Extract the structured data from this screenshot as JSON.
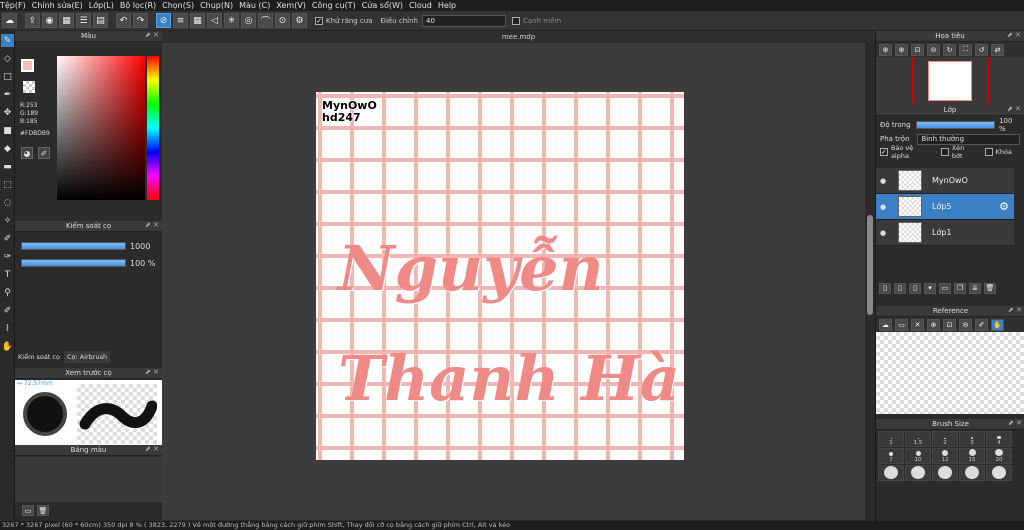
{
  "menu": [
    "Tệp(F)",
    "Chỉnh sửa(E)",
    "Lớp(L)",
    "Bộ lọc(R)",
    "Chọn(S)",
    "Chụp(N)",
    "Màu (C)",
    "Xem(V)",
    "Công cụ(T)",
    "Cửa sổ(W)",
    "Cloud",
    "Help"
  ],
  "toolbar": {
    "antialias_label": "Khử răng cưa",
    "adjust_label": "Điều chỉnh",
    "adjust_value": "40",
    "edge_label": "Cạnh mềm"
  },
  "color_panel": {
    "title": "Màu",
    "fg_color": "#FDBDB9",
    "r": "R:253",
    "g": "G:189",
    "b": "B:185",
    "hex": "#FDBDB9"
  },
  "brush_control": {
    "title": "Kiểm soát cọ",
    "size_value": "1000",
    "opacity_value": "100 %"
  },
  "small_tabs": [
    "Kiểm soát cọ",
    "Cọ: Airbrush"
  ],
  "preview": {
    "title": "Xem trước cọ",
    "size_label": "72.57mm"
  },
  "palette": {
    "title": "Bảng màu"
  },
  "document": {
    "filename": "mee.mdp",
    "signature_line1": "MynOwO",
    "signature_line2": "hd247",
    "text_line1": "Nguyễn",
    "text_line2": "Thanh Hà"
  },
  "navigator": {
    "title": "Hoa tiêu"
  },
  "layer_panel": {
    "title": "Lớp",
    "opacity_label": "Độ trong",
    "opacity_value": "100 %",
    "blend_label": "Pha trộn",
    "blend_value": "Bình thường",
    "protect_alpha": "Bảo vệ alpha",
    "clipping": "Xén bớt",
    "lock": "Khóa",
    "layers": [
      {
        "name": "MynOwO",
        "selected": false
      },
      {
        "name": "Lớp5",
        "selected": true
      },
      {
        "name": "Lớp1",
        "selected": false
      }
    ]
  },
  "reference": {
    "title": "Reference"
  },
  "brush_size": {
    "title": "Brush Size",
    "sizes": [
      "1",
      "1.5",
      "2",
      "3",
      "4",
      "7",
      "10",
      "12",
      "15",
      "20",
      "",
      "",
      "",
      "",
      ""
    ]
  },
  "status": "3267 * 3267 pixel   (60 * 60cm)   350 dpi   8 %   ( 3823, 2279 )   Vẽ một đường thẳng bằng cách giữ phím Shift, Thay đổi cỡ cọ bằng cách giữ phím Ctrl, Alt và kéo"
}
